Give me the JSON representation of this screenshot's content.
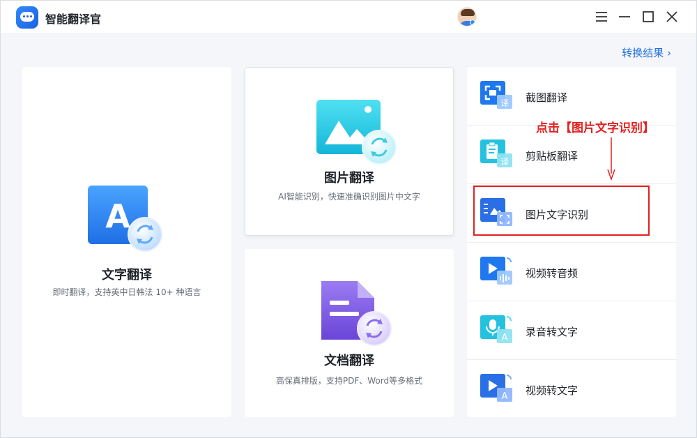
{
  "app": {
    "title": "智能翻译官"
  },
  "window_controls": {
    "menu_icon": "menu-icon",
    "minimize_icon": "minimize-icon",
    "maximize_icon": "maximize-icon",
    "close_icon": "close-icon"
  },
  "header": {
    "result_link": "转换结果 ›"
  },
  "cards": {
    "text_translate": {
      "title": "文字翻译",
      "desc": "即时翻译，支持英中日韩法 10+ 种语言",
      "icon": "text-translate-icon"
    },
    "image_translate": {
      "title": "图片翻译",
      "desc": "AI智能识别，快速准确识别图片中文字",
      "icon": "image-translate-icon"
    },
    "doc_translate": {
      "title": "文档翻译",
      "desc": "高保真排版，支持PDF、Word等多格式",
      "icon": "document-translate-icon"
    }
  },
  "tools": [
    {
      "label": "截图翻译",
      "icon": "screenshot-translate-icon",
      "badge": "译"
    },
    {
      "label": "剪贴板翻译",
      "icon": "clipboard-translate-icon",
      "badge": "译"
    },
    {
      "label": "图片文字识别",
      "icon": "image-ocr-icon"
    },
    {
      "label": "视频转音频",
      "icon": "video-to-audio-icon"
    },
    {
      "label": "录音转文字",
      "icon": "recording-to-text-icon",
      "badge": "A"
    },
    {
      "label": "视频转文字",
      "icon": "video-to-text-icon",
      "badge": "A"
    }
  ],
  "annotation": {
    "text": "点击【图片文字识别】"
  },
  "colors": {
    "accent": "#1f6fe5",
    "annotation_red": "#e4201e",
    "purple": "#7b57e6"
  }
}
